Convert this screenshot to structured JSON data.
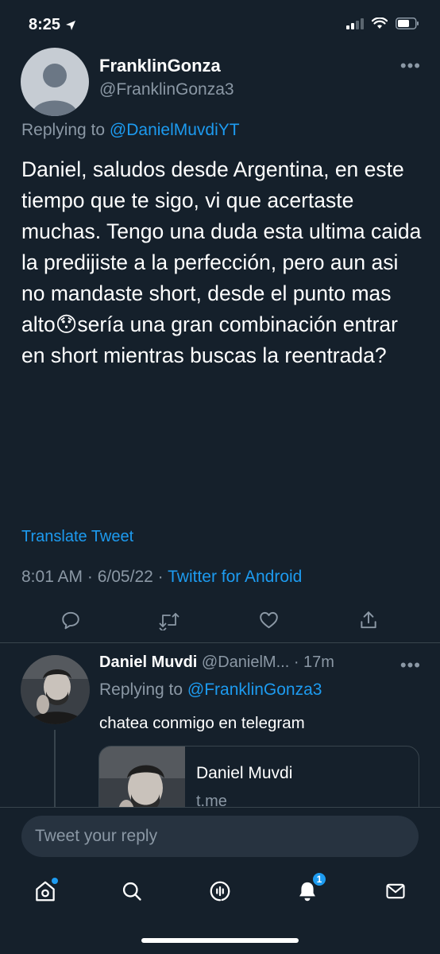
{
  "status_bar": {
    "time": "8:25"
  },
  "tweet": {
    "author_name": "FranklinGonza",
    "author_handle": "@FranklinGonza3",
    "replying_prefix": "Replying to ",
    "replying_to": "@DanielMuvdiYT",
    "text_before_emoji": "Daniel, saludos desde Argentina, en este tiempo que te sigo, vi que acertaste muchas. Tengo una duda esta ultima caida la predijiste a la perfección, pero aun asi no mandaste short, desde el punto mas alto",
    "emoji": "😯",
    "text_after_emoji": "sería una gran combinación entrar en short mientras buscas la reentrada?",
    "translate_label": "Translate Tweet",
    "time": "8:01 AM",
    "date": "6/05/22",
    "separator": " · ",
    "source": "Twitter for Android"
  },
  "reply": {
    "author_name": "Daniel Muvdi",
    "author_handle": "@DanielM...",
    "age": "17m",
    "age_separator": " · ",
    "replying_prefix": "Replying to ",
    "replying_to": "@FranklinGonza3",
    "text": "chatea conmigo en telegram",
    "card": {
      "title": "Daniel Muvdi",
      "domain": "t.me"
    }
  },
  "composer": {
    "placeholder": "Tweet your reply"
  },
  "tabbar": {
    "notifications_badge": "1"
  },
  "colors": {
    "background": "#15202b",
    "accent": "#1d9bf0",
    "secondary_text": "#8b98a5",
    "border": "#38444d"
  }
}
